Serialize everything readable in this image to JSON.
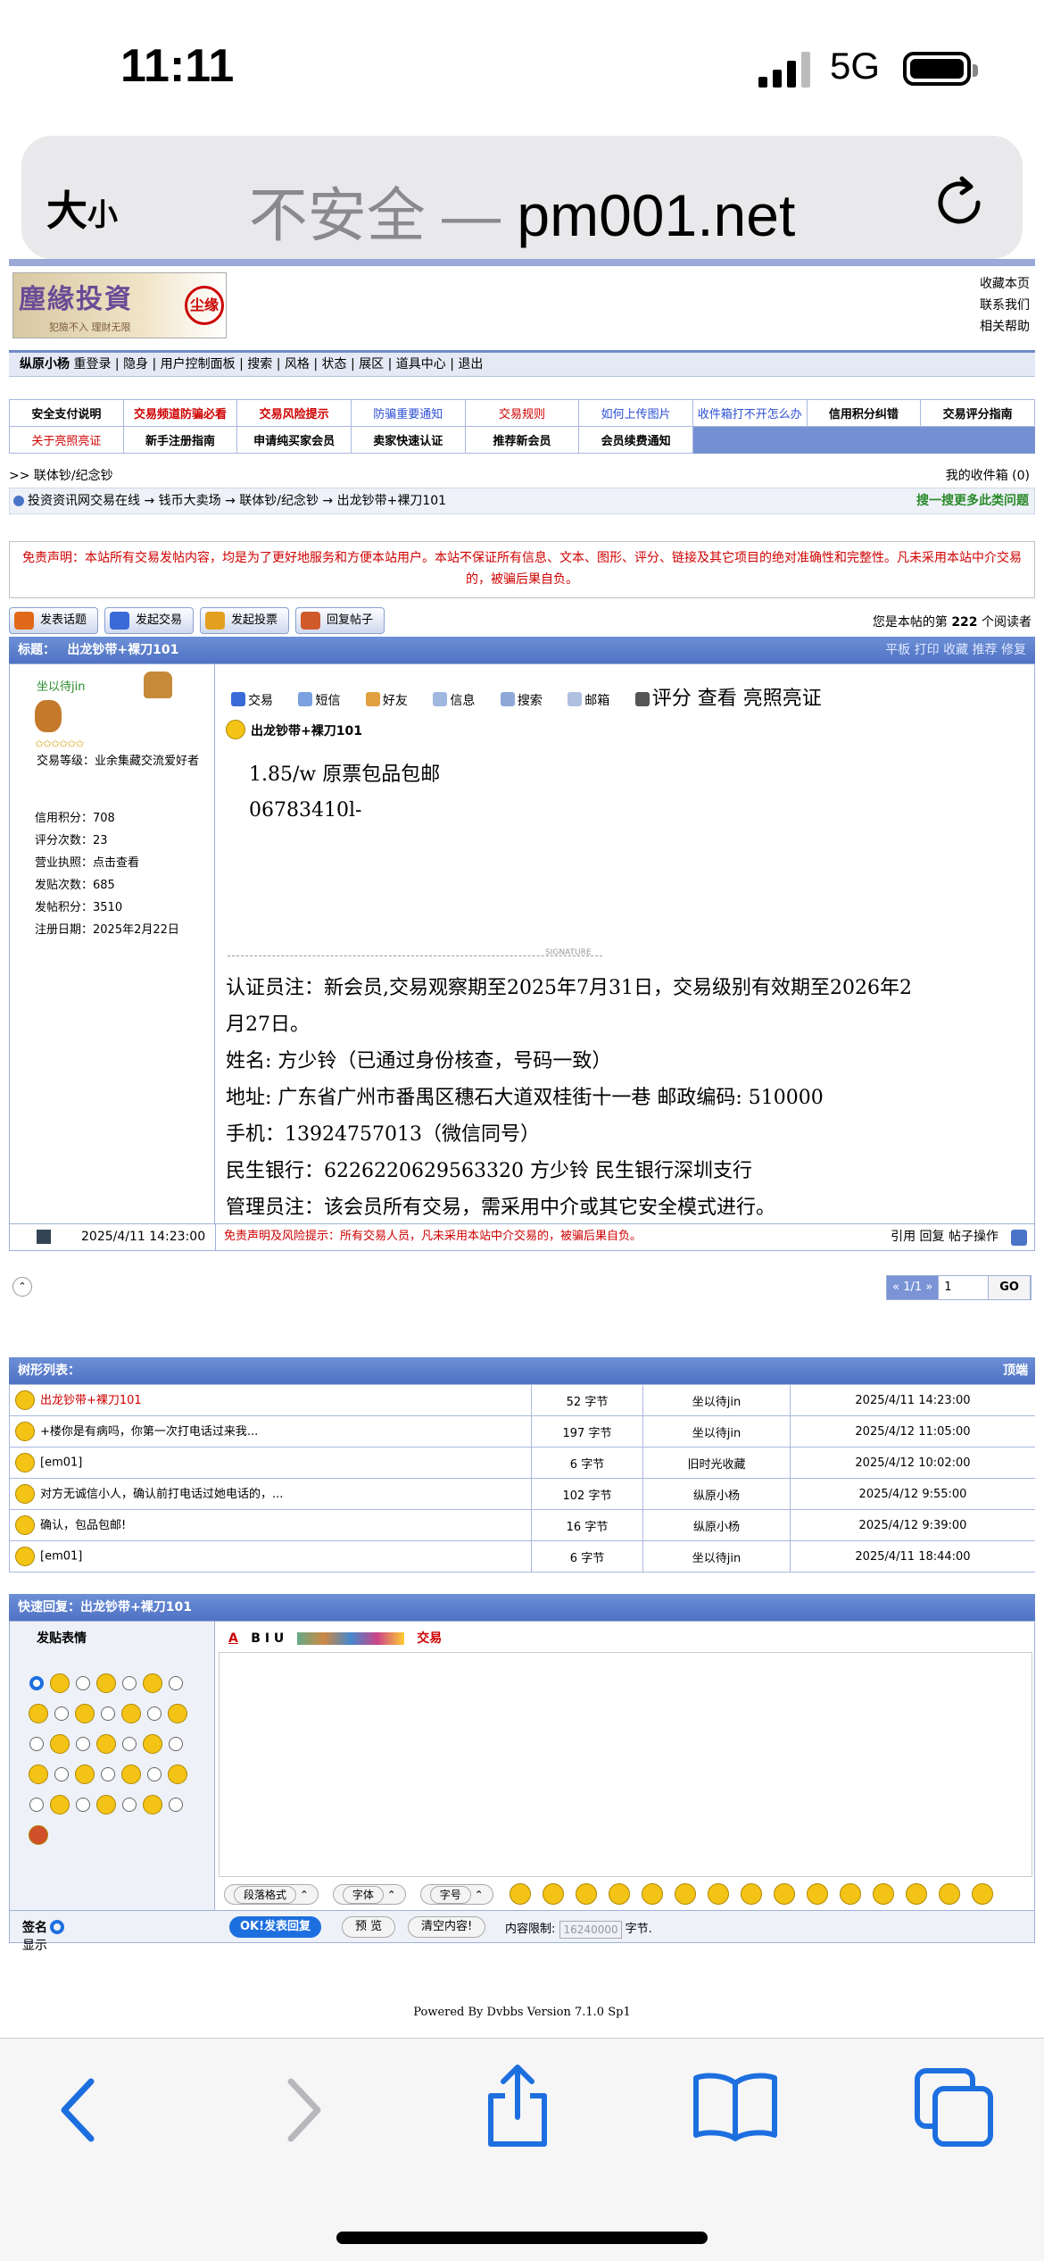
{
  "status": {
    "time": "11:11",
    "network": "5G"
  },
  "browser": {
    "aa_big": "大",
    "aa_small": "小",
    "insecure": "不安全",
    "sep": " — ",
    "domain": "pm001.net"
  },
  "site": {
    "logo_title": "塵緣投資",
    "logo_sub": "犯險不入 理財无限",
    "logo_seal": "尘缘",
    "toplinks": [
      "收藏本页",
      "联系我们",
      "相关帮助"
    ],
    "nav": {
      "user": "纵原小杨",
      "items": "重登录 | 隐身 | 用户控制面板 | 搜索 | 风格 | 状态 | 展区 | 道具中心 | 退出"
    }
  },
  "notices": {
    "row1": [
      "安全支付说明",
      "交易频道防骗必看",
      "交易风险提示",
      "防骗重要通知",
      "交易规则",
      "如何上传图片",
      "收件箱打不开怎么办",
      "信用积分纠错",
      "交易评分指南"
    ],
    "row2": [
      "关于亮照亮证",
      "新手注册指南",
      "申请纯买家会员",
      "卖家快速认证",
      "推荐新会员",
      "会员续费通知"
    ]
  },
  "crumbs": {
    "line1": ">> 联体钞/纪念钞",
    "inbox": "我的收件箱 (0)",
    "line2": "投资资讯网交易在线 → 钱币大卖场 → 联体钞/纪念钞 → 出龙钞带+裸刀101",
    "search_more": "搜一搜更多此类问题"
  },
  "disclaimer": "免责声明：本站所有交易发帖内容，均是为了更好地服务和方便本站用户。本站不保证所有信息、文本、图形、评分、链接及其它项目的绝对准确性和完整性。凡未采用本站中介交易的，被骗后果自负。",
  "post_buttons": [
    "发表话题",
    "发起交易",
    "发起投票",
    "回复帖子"
  ],
  "readers": {
    "prefix": "您是本帖的第 ",
    "count": "222",
    "suffix": " 个阅读者"
  },
  "thread_header": {
    "label": "标题：",
    "title": "出龙钞带+裸刀101",
    "actions": "平板  打印  收藏  推荐  修复"
  },
  "user": {
    "name": "坐以待jin",
    "rank": "交易等级：业余集藏交流爱好者",
    "stats": [
      "信用积分：708",
      "评分次数：23",
      "营业执照：点击查看",
      "发贴次数：685",
      "发帖积分：3510",
      "注册日期：2025年2月22日"
    ]
  },
  "post": {
    "tools": [
      "交易",
      "短信",
      "好友",
      "信息",
      "搜索",
      "邮箱"
    ],
    "tools_big": "评分  查看 亮照亮证",
    "title": "出龙钞带+裸刀101",
    "body": [
      "1.85/w  原票包品包邮",
      "06783410l-"
    ],
    "sig_label": "SIGNATURE",
    "sig_lines": [
      "认证员注：新会员,交易观察期至2025年7月31日，交易级别有效期至2026年2月27日。",
      "姓名: 方少铃（已通过身份核查，号码一致）",
      "地址: 广东省广州市番禺区穗石大道双桂街十一巷  邮政编码: 510000",
      "手机：13924757013（微信同号）",
      "民生银行：6226220629563320  方少铃   民生银行深圳支行",
      "管理员注：该会员所有交易，需采用中介或其它安全模式进行。"
    ],
    "time": "2025/4/11 14:23:00",
    "warning": "免责声明及风险提示：所有交易人员，凡未采用本站中介交易的，被骗后果自负。",
    "actions": "引用   回复   帖子操作"
  },
  "pager": {
    "nav": "« 1/1 »",
    "page": "1",
    "go": "GO",
    "circle": "⌃"
  },
  "tree": {
    "header": "树形列表：",
    "top": "顶端",
    "rows": [
      [
        "出龙钞带+裸刀101",
        "52 字节",
        "坐以待jin",
        "2025/4/11 14:23:00"
      ],
      [
        "+楼你是有病吗，你第一次打电话过来我...",
        "197 字节",
        "坐以待jin",
        "2025/4/12 11:05:00"
      ],
      [
        "[em01]",
        "6 字节",
        "旧时光收藏",
        "2025/4/12 10:02:00"
      ],
      [
        "对方无诚信小人，确认前打电话过她电话的，...",
        "102 字节",
        "纵原小杨",
        "2025/4/12 9:55:00"
      ],
      [
        "确认，包品包邮!",
        "16 字节",
        "纵原小杨",
        "2025/4/12 9:39:00"
      ],
      [
        "[em01]",
        "6 字节",
        "坐以待jin",
        "2025/4/11 18:44:00"
      ]
    ]
  },
  "quick": {
    "header": "快速回复：出龙钞带+裸刀101",
    "emoji_label": "发贴表情",
    "tools_text": "B  I  U",
    "trade": "交易",
    "selects": [
      "段落格式",
      "字体",
      "字号"
    ],
    "sig_label": "签名",
    "sig_show": "显示",
    "ok": "OK!发表回复",
    "preview": "预 览",
    "clear": "清空内容!",
    "limit_label": "内容限制:",
    "limit_value": "16240000",
    "limit_unit": "字节."
  },
  "powered": "Powered By Dvbbs Version 7.1.0 Sp1"
}
